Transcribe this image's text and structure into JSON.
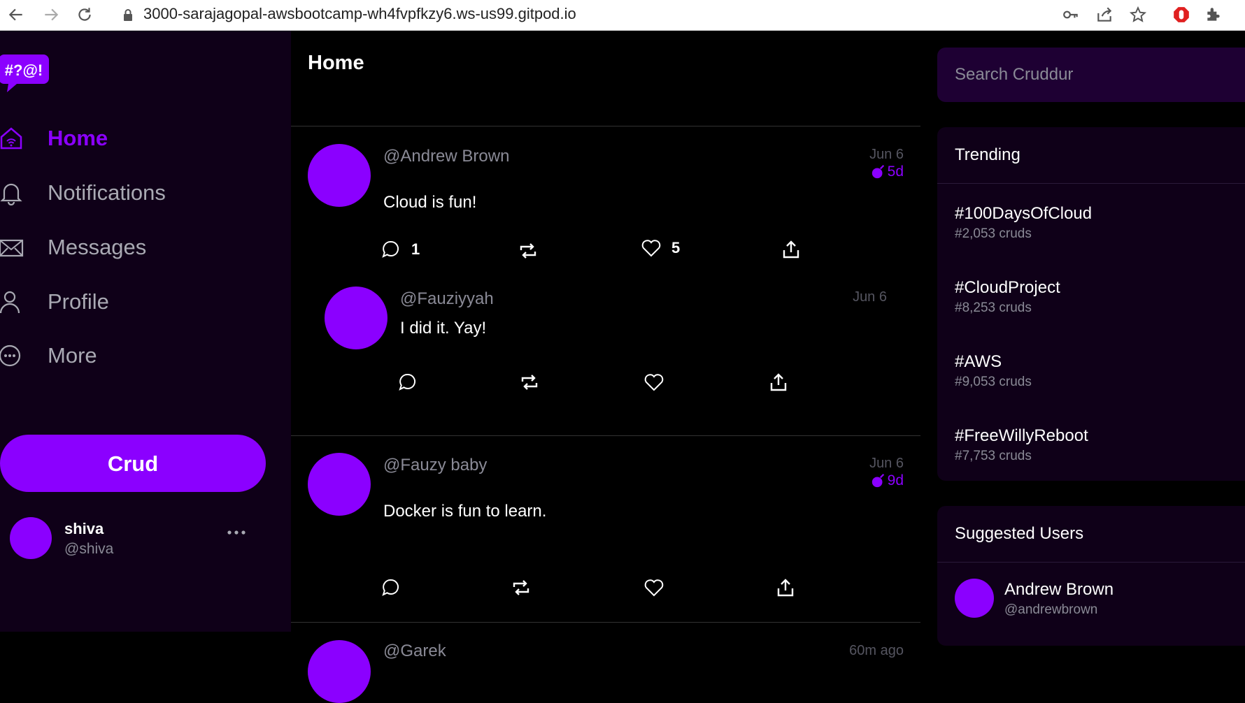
{
  "browser": {
    "url": "3000-sarajagopal-awsbootcamp-wh4fvpfkzy6.ws-us99.gitpod.io"
  },
  "app": {
    "logo_text": "#?@!",
    "brand_color": "#8b00ff"
  },
  "sidebar": {
    "items": [
      {
        "label": "Home",
        "icon": "home-icon",
        "active": true
      },
      {
        "label": "Notifications",
        "icon": "bell-icon",
        "active": false
      },
      {
        "label": "Messages",
        "icon": "envelope-icon",
        "active": false
      },
      {
        "label": "Profile",
        "icon": "user-icon",
        "active": false
      },
      {
        "label": "More",
        "icon": "more-circle-icon",
        "active": false
      }
    ],
    "crud_button": "Crud",
    "profile": {
      "name": "shiva",
      "handle": "@shiva"
    }
  },
  "feed": {
    "title": "Home",
    "activities": [
      {
        "handle": "@Andrew Brown",
        "date": "Jun 6",
        "expires": "5d",
        "message": "Cloud is fun!",
        "replies_count": "1",
        "likes_count": "5",
        "reply": {
          "handle": "@Fauziyyah",
          "date": "Jun 6",
          "message": "I did it. Yay!"
        }
      },
      {
        "handle": "@Fauzy baby",
        "date": "Jun 6",
        "expires": "9d",
        "message": "Docker is fun to learn."
      },
      {
        "handle": "@Garek",
        "date": "60m ago"
      }
    ]
  },
  "right": {
    "search_placeholder": "Search Cruddur",
    "trending": {
      "title": "Trending",
      "items": [
        {
          "tag": "#100DaysOfCloud",
          "count": "#2,053 cruds"
        },
        {
          "tag": "#CloudProject",
          "count": "#8,253 cruds"
        },
        {
          "tag": "#AWS",
          "count": "#9,053 cruds"
        },
        {
          "tag": "#FreeWillyReboot",
          "count": "#7,753 cruds"
        }
      ]
    },
    "suggested": {
      "title": "Suggested Users",
      "users": [
        {
          "name": "Andrew Brown",
          "handle": "@andrewbrown"
        }
      ]
    }
  }
}
